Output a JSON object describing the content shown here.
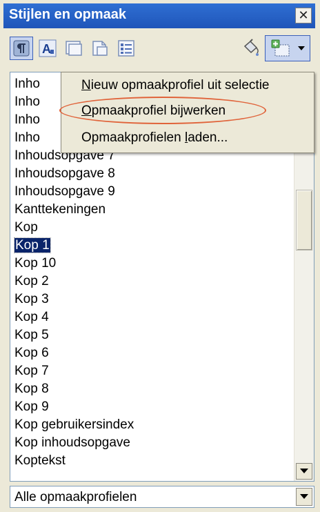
{
  "window": {
    "title": "Stijlen en opmaak",
    "close_icon": "close-icon"
  },
  "toolbar": {
    "buttons": [
      {
        "name": "paragraph-styles-icon",
        "active": true
      },
      {
        "name": "character-styles-icon",
        "active": false
      },
      {
        "name": "frame-styles-icon",
        "active": false
      },
      {
        "name": "page-styles-icon",
        "active": false
      },
      {
        "name": "list-styles-icon",
        "active": false
      }
    ],
    "fill_format_icon": "fill-format-mode-icon",
    "new_style_icon": "new-style-from-selection-icon"
  },
  "styles_list": {
    "items": [
      "Inho",
      "Inho",
      "Inho",
      "Inho",
      "Inhoudsopgave 7",
      "Inhoudsopgave 8",
      "Inhoudsopgave 9",
      "Kanttekeningen",
      "Kop",
      "Kop 1",
      "Kop 10",
      "Kop 2",
      "Kop 3",
      "Kop 4",
      "Kop 5",
      "Kop 6",
      "Kop 7",
      "Kop 8",
      "Kop 9",
      "Kop gebruikersindex",
      "Kop inhoudsopgave",
      "Koptekst"
    ],
    "selected": "Kop 1"
  },
  "popup_menu": {
    "items": [
      {
        "pre": "",
        "u": "N",
        "post": "ieuw opmaakprofiel uit selectie"
      },
      {
        "pre": "",
        "u": "O",
        "post": "pmaakprofiel bijwerken"
      },
      {
        "pre": "Opmaakprofielen ",
        "u": "l",
        "post": "aden..."
      }
    ],
    "highlighted": "Opmaakprofiel bijwerken"
  },
  "filter": {
    "value": "Alle opmaakprofielen"
  },
  "colors": {
    "titlebar": "#2563c9",
    "selection": "#0a246a",
    "highlight_ellipse": "#e0633a"
  }
}
